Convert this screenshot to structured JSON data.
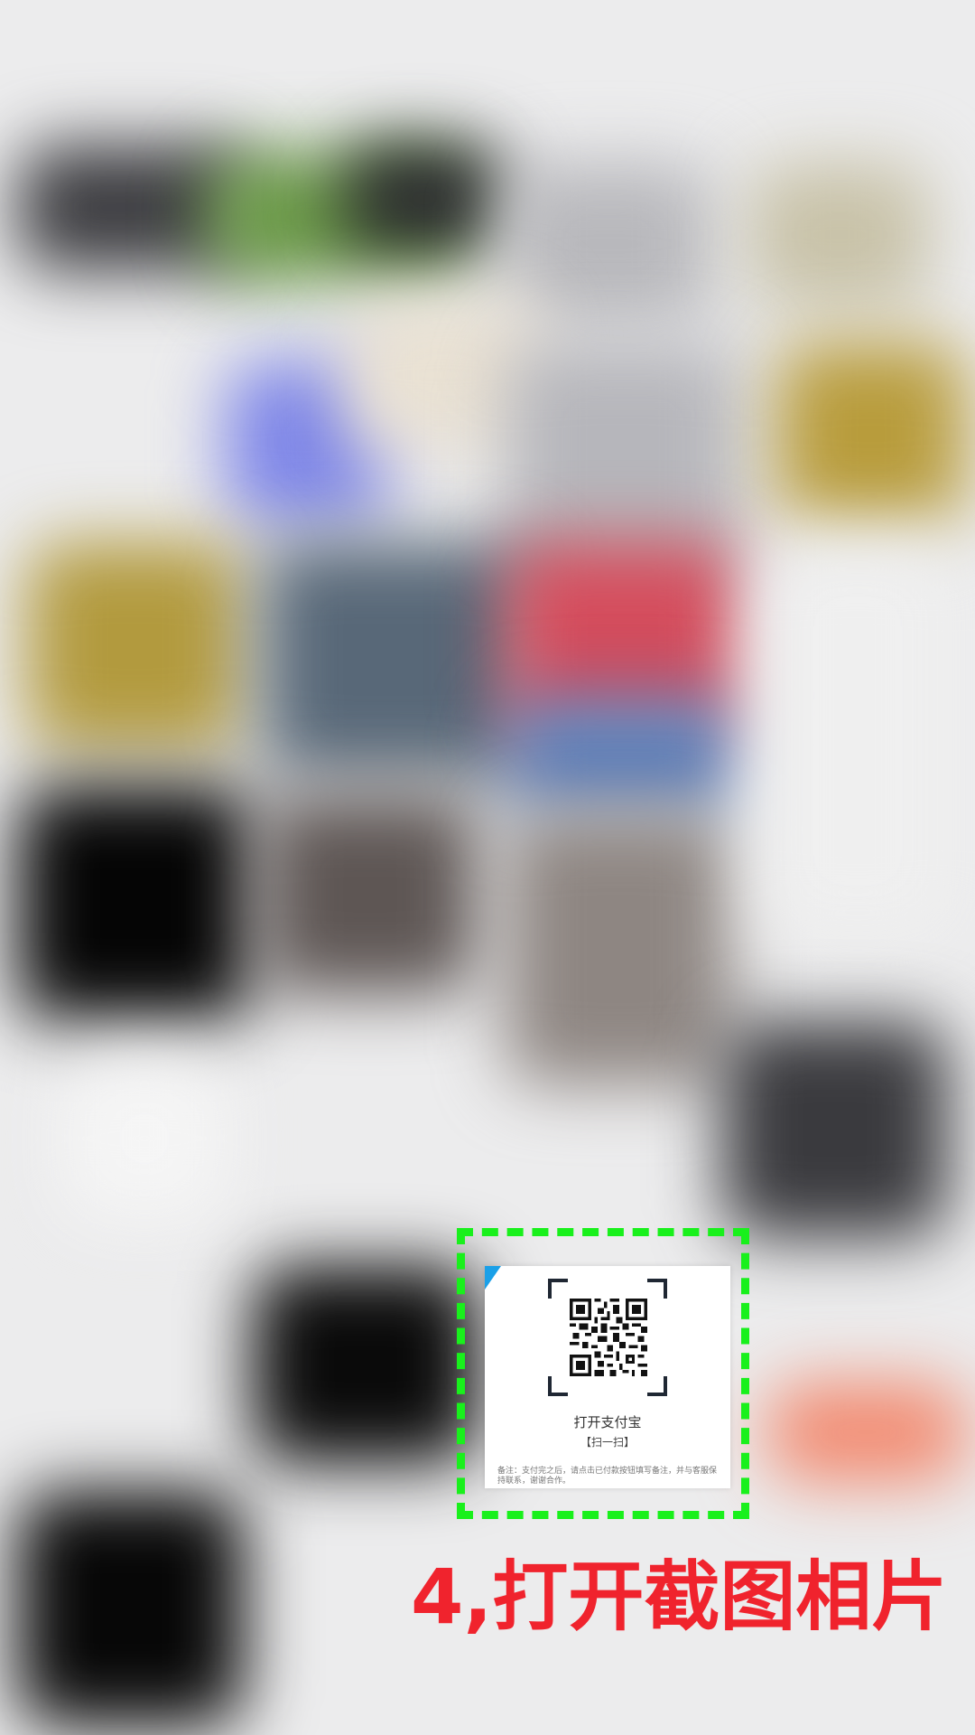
{
  "qr_card": {
    "title": "打开支付宝",
    "subtitle": "【扫一扫】",
    "note": "备注：支付完之后，请点击已付款按钮填写备注，并与客服保持联系，谢谢合作。"
  },
  "instruction": {
    "text": "4,打开截图相片"
  },
  "colors": {
    "highlight": "#19f01c",
    "caption": "#f0232d",
    "card_accent": "#1aa0e8"
  },
  "icons": [
    "qr-code-icon",
    "scan-frame-icon"
  ]
}
